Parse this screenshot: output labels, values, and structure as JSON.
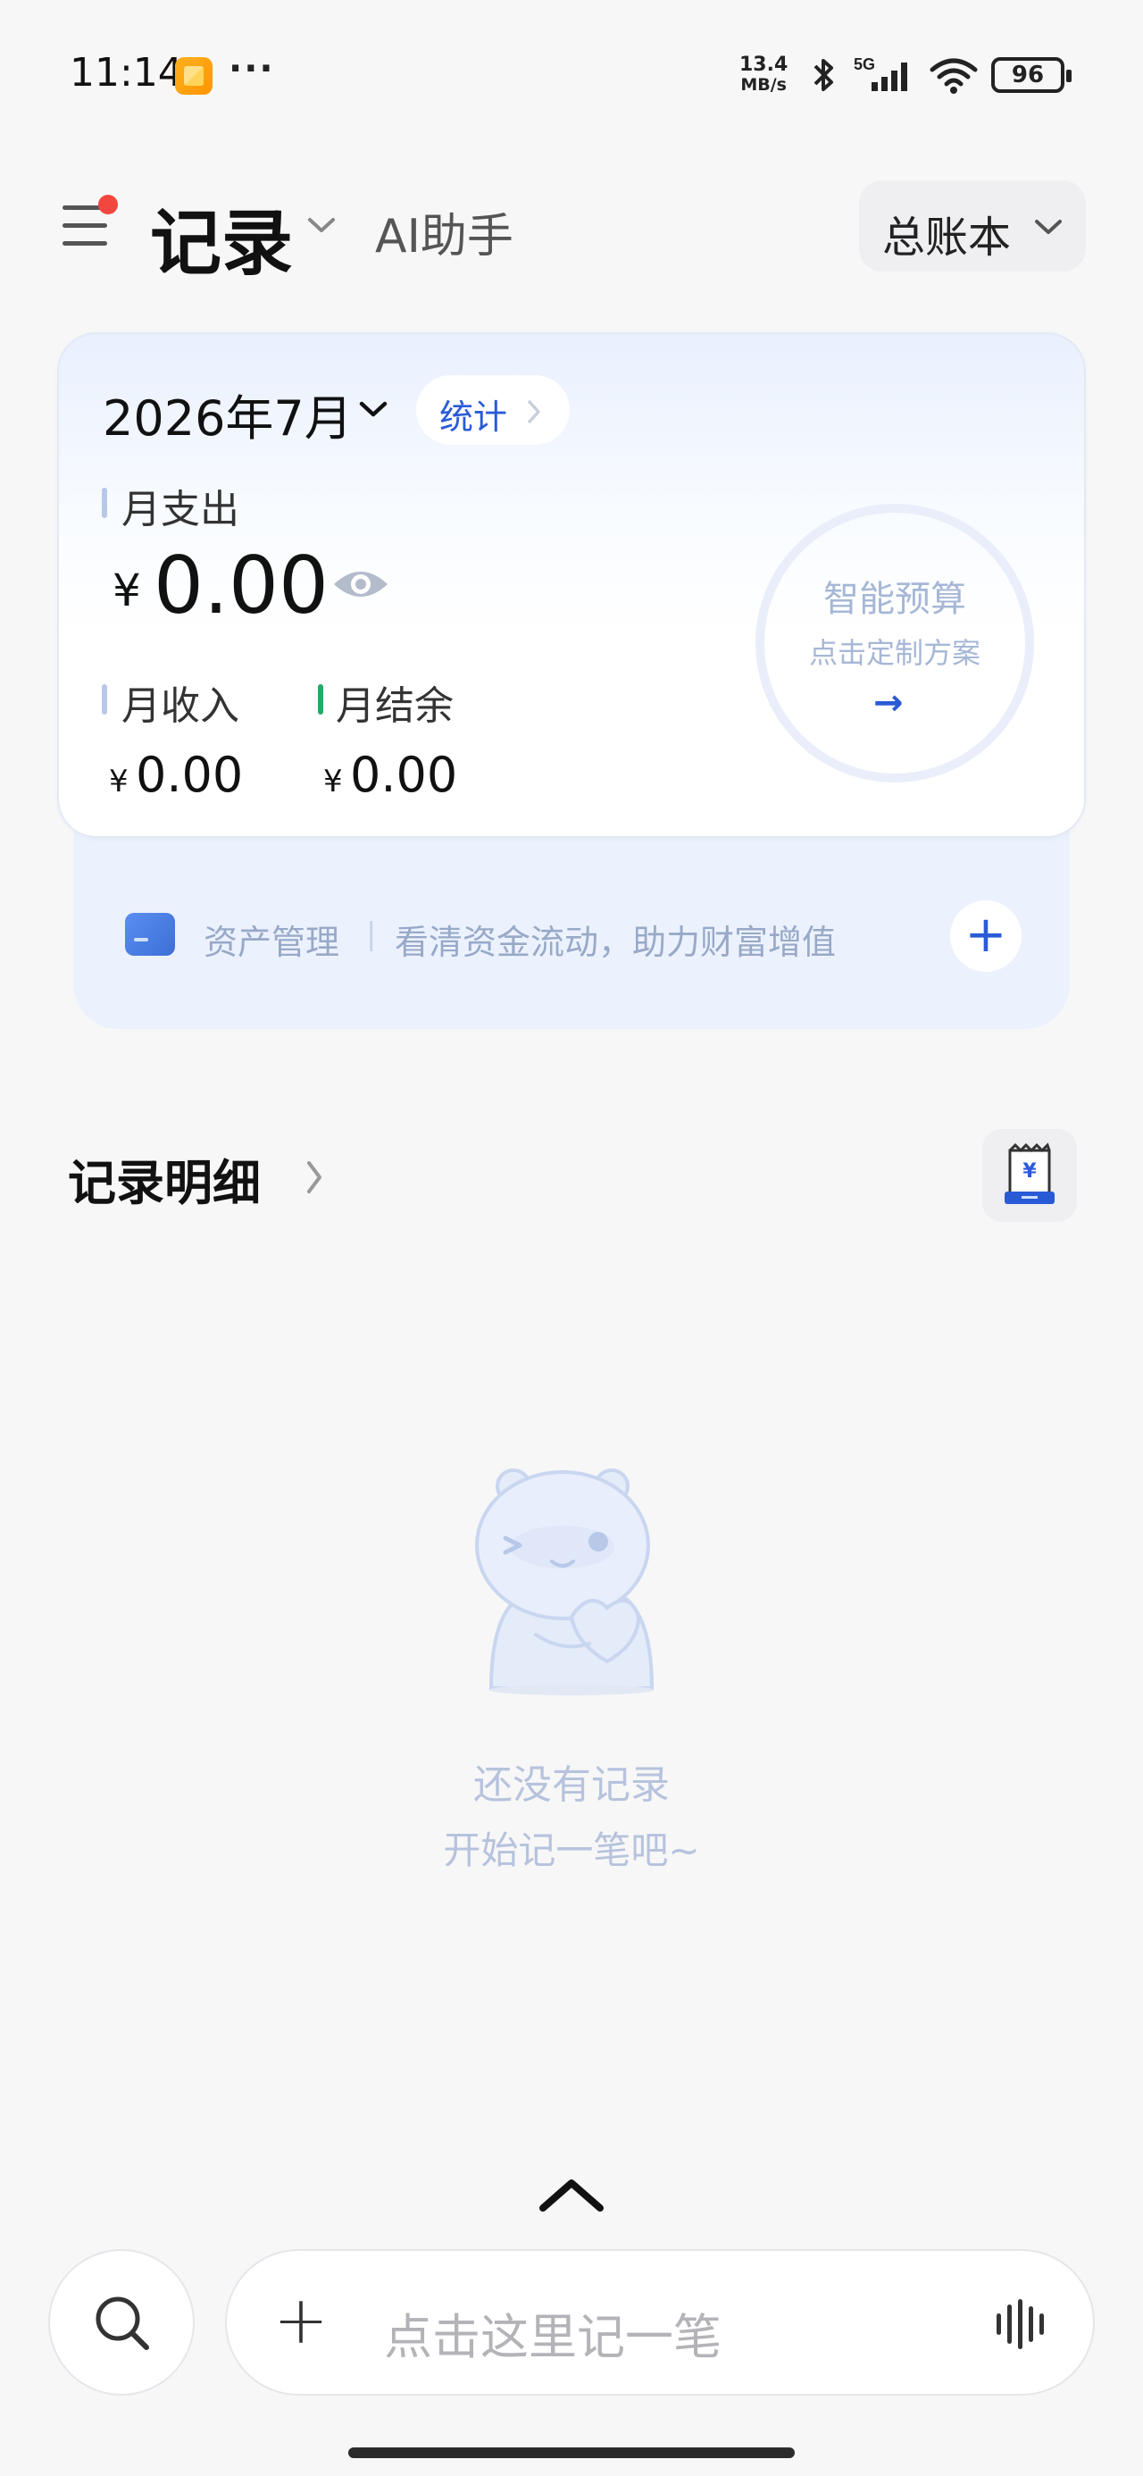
{
  "status_bar": {
    "time": "11:14",
    "more": "···",
    "net_speed_value": "13.4",
    "net_speed_unit": "MB/s",
    "network": "5G",
    "battery": "96"
  },
  "nav": {
    "tab_record": "记录",
    "tab_ai": "AI助手",
    "ledger": "总账本"
  },
  "summary": {
    "month": "2026年7月",
    "stats_label": "统计",
    "expense_label": "月支出",
    "expense_currency": "¥",
    "expense_value": "0.00",
    "income_label": "月收入",
    "income_currency": "¥",
    "income_value": "0.00",
    "balance_label": "月结余",
    "balance_currency": "¥",
    "balance_value": "0.00",
    "budget_title": "智能预算",
    "budget_sub": "点击定制方案",
    "budget_arrow": "→"
  },
  "asset_banner": {
    "title": "资产管理",
    "separator": "|",
    "desc": "看清资金流动，助力财富增值",
    "add": "+"
  },
  "records": {
    "title": "记录明细",
    "empty_title": "还没有记录",
    "empty_sub": "开始记一笔吧~"
  },
  "bottom": {
    "entry_plus": "+",
    "entry_placeholder": "点击这里记一笔"
  },
  "colors": {
    "accent": "#2a5bd7",
    "balance_mark": "#2aa76a",
    "notification_dot": "#f2473f",
    "muted_text": "#b7c3dd"
  }
}
